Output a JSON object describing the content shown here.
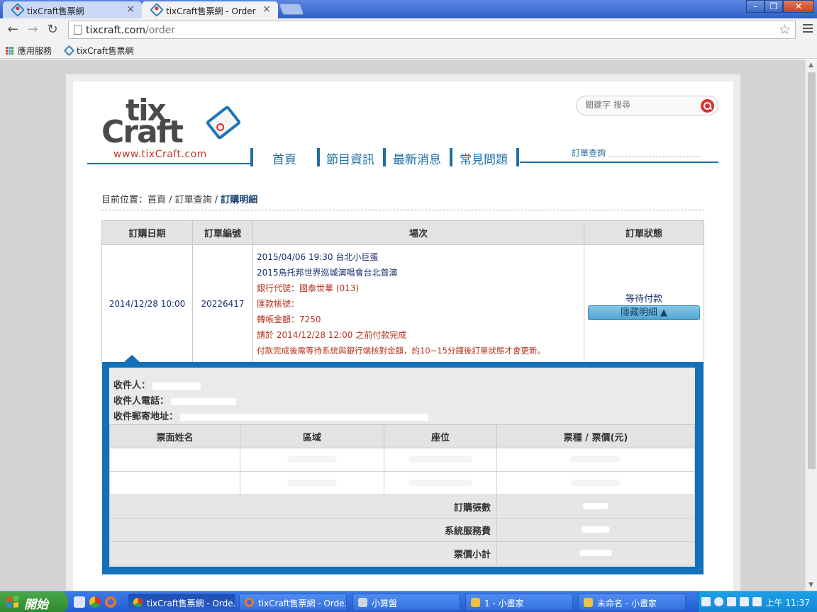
{
  "browser": {
    "tabs": [
      {
        "label": "tixCraft售票網"
      },
      {
        "label": "tixCraft售票網 - Order"
      }
    ],
    "url_host": "tixcraft.com",
    "url_path": "/order",
    "bookmarks": [
      {
        "label": "應用服務"
      },
      {
        "label": "tixCraft售票網"
      }
    ]
  },
  "site": {
    "logo_tix": "tix",
    "logo_craft": "Craft",
    "logo_url": "www.tixCraft.com",
    "search_placeholder": "關鍵字 搜尋",
    "nav": [
      {
        "label": "首頁"
      },
      {
        "label": "節目資訊"
      },
      {
        "label": "最新消息"
      },
      {
        "label": "常見問題"
      }
    ],
    "order_query": "訂單查詢"
  },
  "breadcrumb": {
    "prefix": "目前位置：首頁 / 訂單查詢 / ",
    "current": "訂購明細"
  },
  "order_table": {
    "headers": [
      "訂購日期",
      "訂單編號",
      "場次",
      "訂單狀態"
    ],
    "row": {
      "date": "2014/12/28 10:00",
      "order_no": "20226417",
      "event_line1": "2015/04/06 19:30 台北小巨蛋",
      "event_line2": "2015烏托邦世界巡城演唱會台北首演",
      "bank_code": "銀行代號：國泰世華 (013)",
      "account": "匯款帳號：",
      "amount": "轉帳金額：7250",
      "deadline": "請於 2014/12/28 12:00 之前付款完成",
      "note": "付款完成後需等待系統與銀行端核對金額，約10~15分鐘後訂單狀態才會更新。",
      "status": "等待付款",
      "toggle_button": "隱藏明細 ▲"
    }
  },
  "recipient": {
    "name_label": "收件人：",
    "phone_label": "收件人電話：",
    "address_label": "收件郵寄地址："
  },
  "ticket_table": {
    "headers": [
      "票面姓名",
      "區域",
      "座位",
      "票種 / 票價(元)"
    ],
    "summary": [
      {
        "label": "訂購張數"
      },
      {
        "label": "系統服務費"
      },
      {
        "label": "票價小計"
      }
    ]
  },
  "taskbar": {
    "start": "開始",
    "tasks": [
      {
        "label": "tixCraft售票網 - Orde..."
      },
      {
        "label": "tixCraft售票網 - Orde..."
      },
      {
        "label": "小算盤"
      },
      {
        "label": "1 - 小畫家"
      },
      {
        "label": "未命名 - 小畫家"
      }
    ],
    "clock": "上午 11:37"
  },
  "colors": {
    "brand_blue": "#1d6fa5",
    "panel_blue": "#1470b8",
    "alert_red": "#b5331f"
  }
}
